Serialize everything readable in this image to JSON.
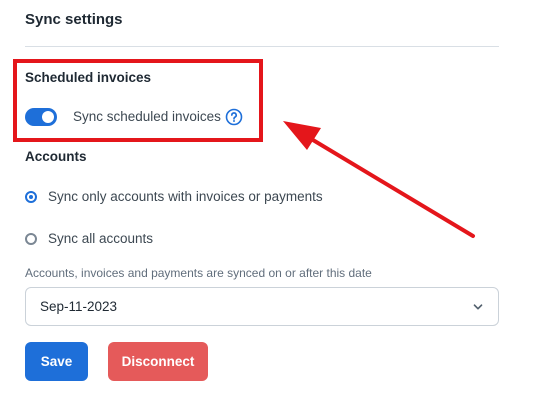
{
  "header": {
    "title": "Sync settings"
  },
  "scheduled": {
    "heading": "Scheduled invoices",
    "toggle_label": "Sync scheduled invoices",
    "toggle_on": true,
    "help_icon": "question-circle-icon"
  },
  "accounts": {
    "heading": "Accounts",
    "options": [
      {
        "label": "Sync only accounts with invoices or payments",
        "selected": true
      },
      {
        "label": "Sync all accounts",
        "selected": false
      }
    ]
  },
  "date_filter": {
    "caption": "Accounts, invoices and payments are synced on or after this date",
    "value": "Sep-11-2023"
  },
  "buttons": {
    "save": "Save",
    "disconnect": "Disconnect"
  },
  "colors": {
    "accent": "#1e6fd9",
    "danger": "#e55a5a",
    "annotation": "#e4161b"
  }
}
